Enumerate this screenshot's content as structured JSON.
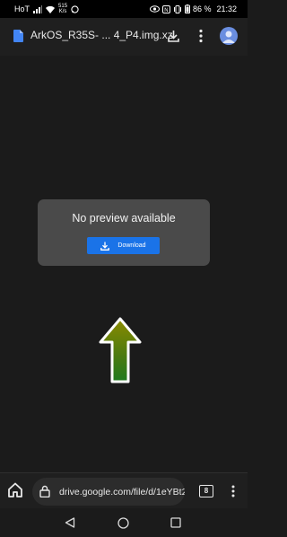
{
  "status_bar": {
    "carrier": "HoT",
    "speed_value": "515",
    "speed_unit": "K/s",
    "battery_percent": "86 %",
    "time": "21:32"
  },
  "app_bar": {
    "file_name": "ArkOS_R35S- ... 4_P4.img.xz",
    "icons": [
      "file-icon",
      "download-icon",
      "more-vert-icon",
      "account-avatar"
    ]
  },
  "preview": {
    "message": "No preview available",
    "download_label": "Download"
  },
  "browser": {
    "url": "drive.google.com/file/d/1eYBt2",
    "tab_count": "8"
  },
  "colors": {
    "accent_blue": "#1a73e8",
    "card_bg": "#4a4a4a",
    "background": "#1b1b1b",
    "arrow_fill_top": "#8a8a00",
    "arrow_fill_bottom": "#1f7a1f"
  }
}
